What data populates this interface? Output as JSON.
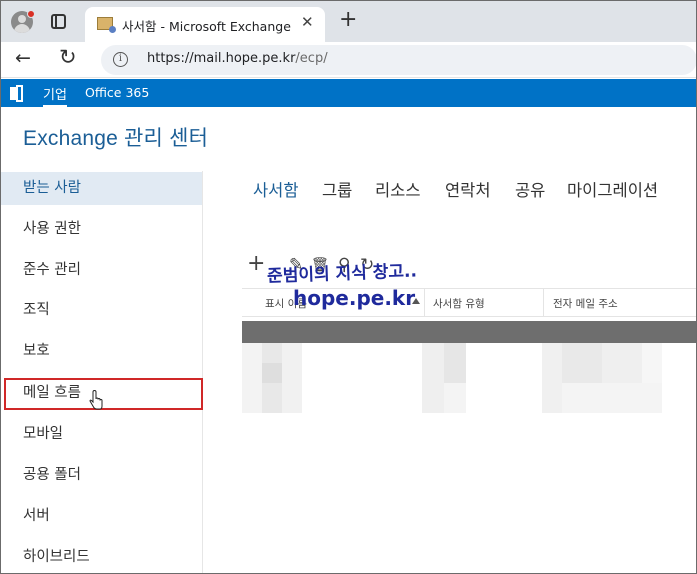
{
  "browser": {
    "tab_title": "사서함 - Microsoft Exchange",
    "tab_close": "✕",
    "new_tab": "+",
    "url_host": "https://mail.hope.pe.kr",
    "url_path": "/ecp/",
    "back_icon": "←",
    "reload_icon": "↻"
  },
  "topbar": {
    "enterprise_label": "기업",
    "office365_label": "Office 365",
    "brand_color": "#0072c6"
  },
  "app": {
    "title": "Exchange 관리 센터"
  },
  "leftnav": {
    "items": [
      {
        "label": "받는 사람"
      },
      {
        "label": "사용 권한"
      },
      {
        "label": "준수 관리"
      },
      {
        "label": "조직"
      },
      {
        "label": "보호"
      },
      {
        "label": "메일 흐름"
      },
      {
        "label": "모바일"
      },
      {
        "label": "공용 폴더"
      },
      {
        "label": "서버"
      },
      {
        "label": "하이브리드"
      }
    ],
    "active": "받는 사람",
    "highlighted": "메일 흐름",
    "highlight_color": "#d02828"
  },
  "subtabs": [
    {
      "label": "사서함"
    },
    {
      "label": "그룹"
    },
    {
      "label": "리소스"
    },
    {
      "label": "연락처"
    },
    {
      "label": "공유"
    },
    {
      "label": "마이그레이션"
    }
  ],
  "toolbar": {
    "add_icon": "+",
    "edit_icon": "✎",
    "delete_icon": "🗑",
    "search_icon": "⚲",
    "refresh_icon": "↻"
  },
  "watermark": {
    "line1": "준범이의 지식 창고..",
    "line2": "hope.pe.kr"
  },
  "table": {
    "columns": [
      {
        "label": "표시 이름"
      },
      {
        "label": "사서함 유형"
      },
      {
        "label": "전자 메일 주소"
      }
    ]
  }
}
